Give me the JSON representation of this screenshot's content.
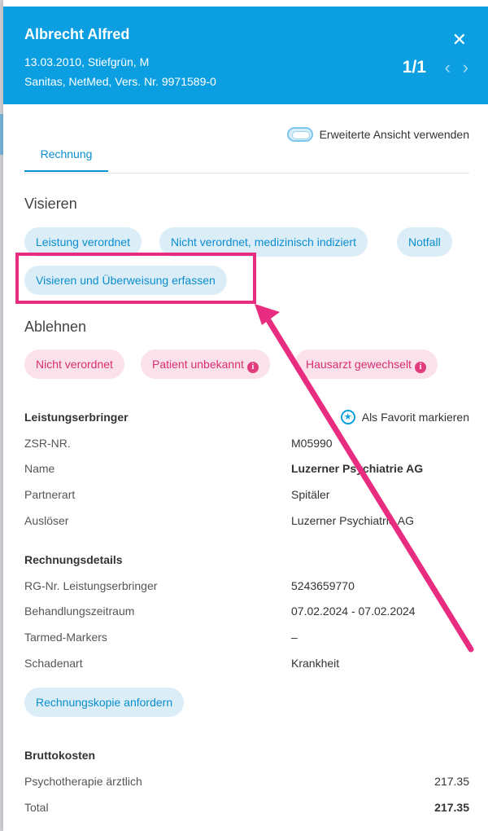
{
  "header": {
    "name": "Albrecht Alfred",
    "line1": "13.03.2010, Stiefgrün, M",
    "line2": "Sanitas, NetMed, Vers. Nr. 9971589-0",
    "pager": "1/1",
    "close_glyph": "✕",
    "prev_glyph": "‹",
    "next_glyph": "›"
  },
  "toggle": {
    "label": "Erweiterte Ansicht verwenden",
    "on": false
  },
  "tabs": [
    {
      "label": "Rechnung",
      "active": true
    }
  ],
  "visieren": {
    "heading": "Visieren",
    "buttons": [
      "Leistung verordnet",
      "Nicht verordnet, medizinisch indiziert",
      "Notfall",
      "Visieren und Überweisung erfassen"
    ]
  },
  "ablehnen": {
    "heading": "Ablehnen",
    "buttons": [
      {
        "label": "Nicht verordnet",
        "info": false
      },
      {
        "label": "Patient unbekannt",
        "info": true
      },
      {
        "label": "Hausarzt gewechselt",
        "info": true
      }
    ],
    "info_glyph": "i"
  },
  "leistungserbringer": {
    "heading": "Leistungserbringer",
    "favorite_label": "Als Favorit markieren",
    "rows": [
      {
        "label": "ZSR-NR.",
        "value": "M05990"
      },
      {
        "label": "Name",
        "value": "Luzerner Psychiatrie AG"
      },
      {
        "label": "Partnerart",
        "value": "Spitäler"
      },
      {
        "label": "Auslöser",
        "value": "Luzerner Psychiatrie AG"
      }
    ]
  },
  "rechnungsdetails": {
    "heading": "Rechnungsdetails",
    "rows": [
      {
        "label": "RG-Nr. Leistungserbringer",
        "value": "5243659770"
      },
      {
        "label": "Behandlungszeitraum",
        "value": "07.02.2024 - 07.02.2024"
      },
      {
        "label": "Tarmed-Markers",
        "value": "–"
      },
      {
        "label": "Schadenart",
        "value": "Krankheit"
      }
    ],
    "copy_button": "Rechnungskopie anfordern"
  },
  "bruttokosten": {
    "heading": "Bruttokosten",
    "rows": [
      {
        "label": "Psychotherapie ärztlich",
        "value": "217.35"
      },
      {
        "label": "Total",
        "value": "217.35"
      }
    ]
  },
  "colors": {
    "header": "#0b9ee0",
    "accent_blue": "#0b8dcf",
    "accent_pink": "#d72f72",
    "annotation": "#e82c80"
  }
}
